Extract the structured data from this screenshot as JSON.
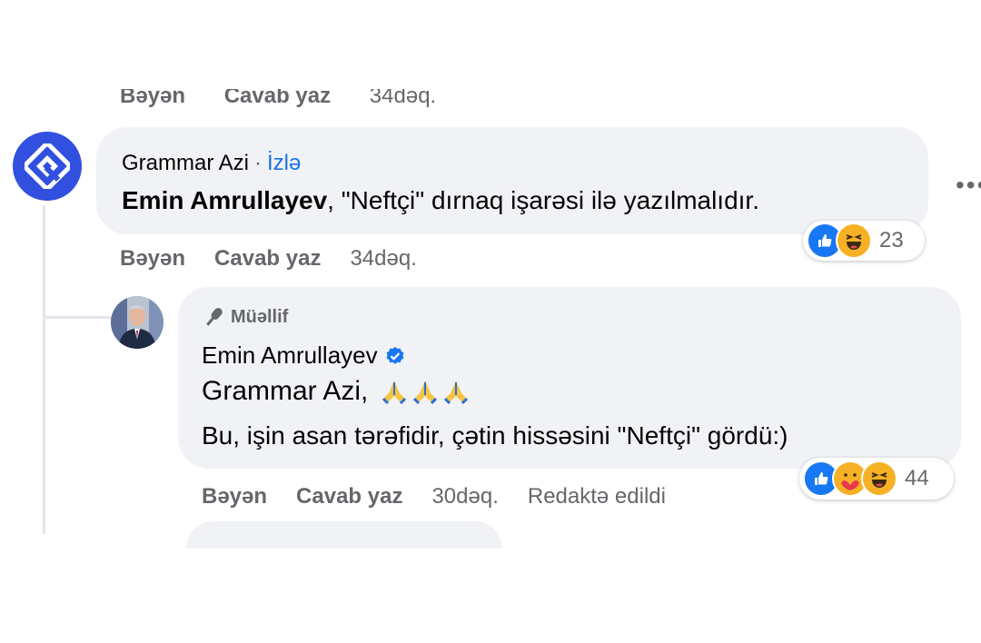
{
  "previous_actions": {
    "like": "Bəyən",
    "reply": "Cavab yaz",
    "time": "34dəq."
  },
  "comment1": {
    "author": "Grammar Azi",
    "separator": "·",
    "follow": "İzlə",
    "mention": "Emin Amrullayev",
    "text": ", \"Neftçi\" dırnaq işarəsi ilə yazılmalıdır.",
    "actions": {
      "like": "Bəyən",
      "reply": "Cavab yaz",
      "time": "34dəq."
    },
    "reactions": {
      "types": [
        "like-icon",
        "haha-icon"
      ],
      "count": "23"
    },
    "more": "•••",
    "avatar_color": "#3150e0"
  },
  "comment2": {
    "badge": "Müəllif",
    "author": "Emin Amrullayev",
    "mention": "Grammar Azi",
    "mention_suffix": ",",
    "text": "Bu, işin asan tərəfidir, çətin hissəsini \"Neftçi\" gördü:)",
    "actions": {
      "like": "Bəyən",
      "reply": "Cavab yaz",
      "time": "30dəq.",
      "edited": "Redaktə edildi"
    },
    "reactions": {
      "types": [
        "like-icon",
        "care-icon",
        "haha-icon"
      ],
      "count": "44"
    }
  },
  "colors": {
    "bubble": "#f0f2f5",
    "secondary_text": "#65676b",
    "link": "#1b74e4",
    "like": "#1877f2",
    "emoji": "#f7b125",
    "verified": "#1877f2"
  }
}
